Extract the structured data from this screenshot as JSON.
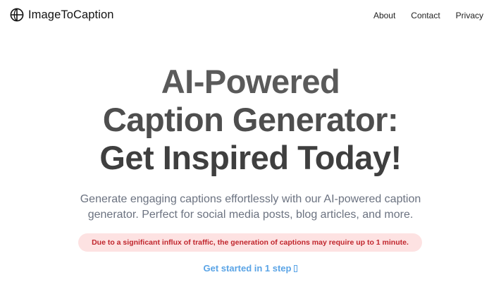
{
  "header": {
    "brand_name": "ImageToCaption",
    "brand_icon": "globe-icon",
    "nav": [
      {
        "label": "About"
      },
      {
        "label": "Contact"
      },
      {
        "label": "Privacy"
      }
    ]
  },
  "hero": {
    "title_lines": [
      "AI-Powered",
      "Caption Generator:",
      "Get Inspired Today!"
    ],
    "subtitle_lines": [
      "Generate engaging captions effortlessly with our AI-powered caption",
      "generator. Perfect for social media posts, blog articles, and more."
    ],
    "notice": "Due to a significant influx of traffic, the generation of captions may require up to 1 minute.",
    "cta_label": "Get started in 1 step",
    "cta_icon": "arrow-icon"
  },
  "colors": {
    "notice_bg": "#fde2e2",
    "notice_text": "#c0262d",
    "cta": "#5aa4e6",
    "subtitle": "#6b7280"
  }
}
